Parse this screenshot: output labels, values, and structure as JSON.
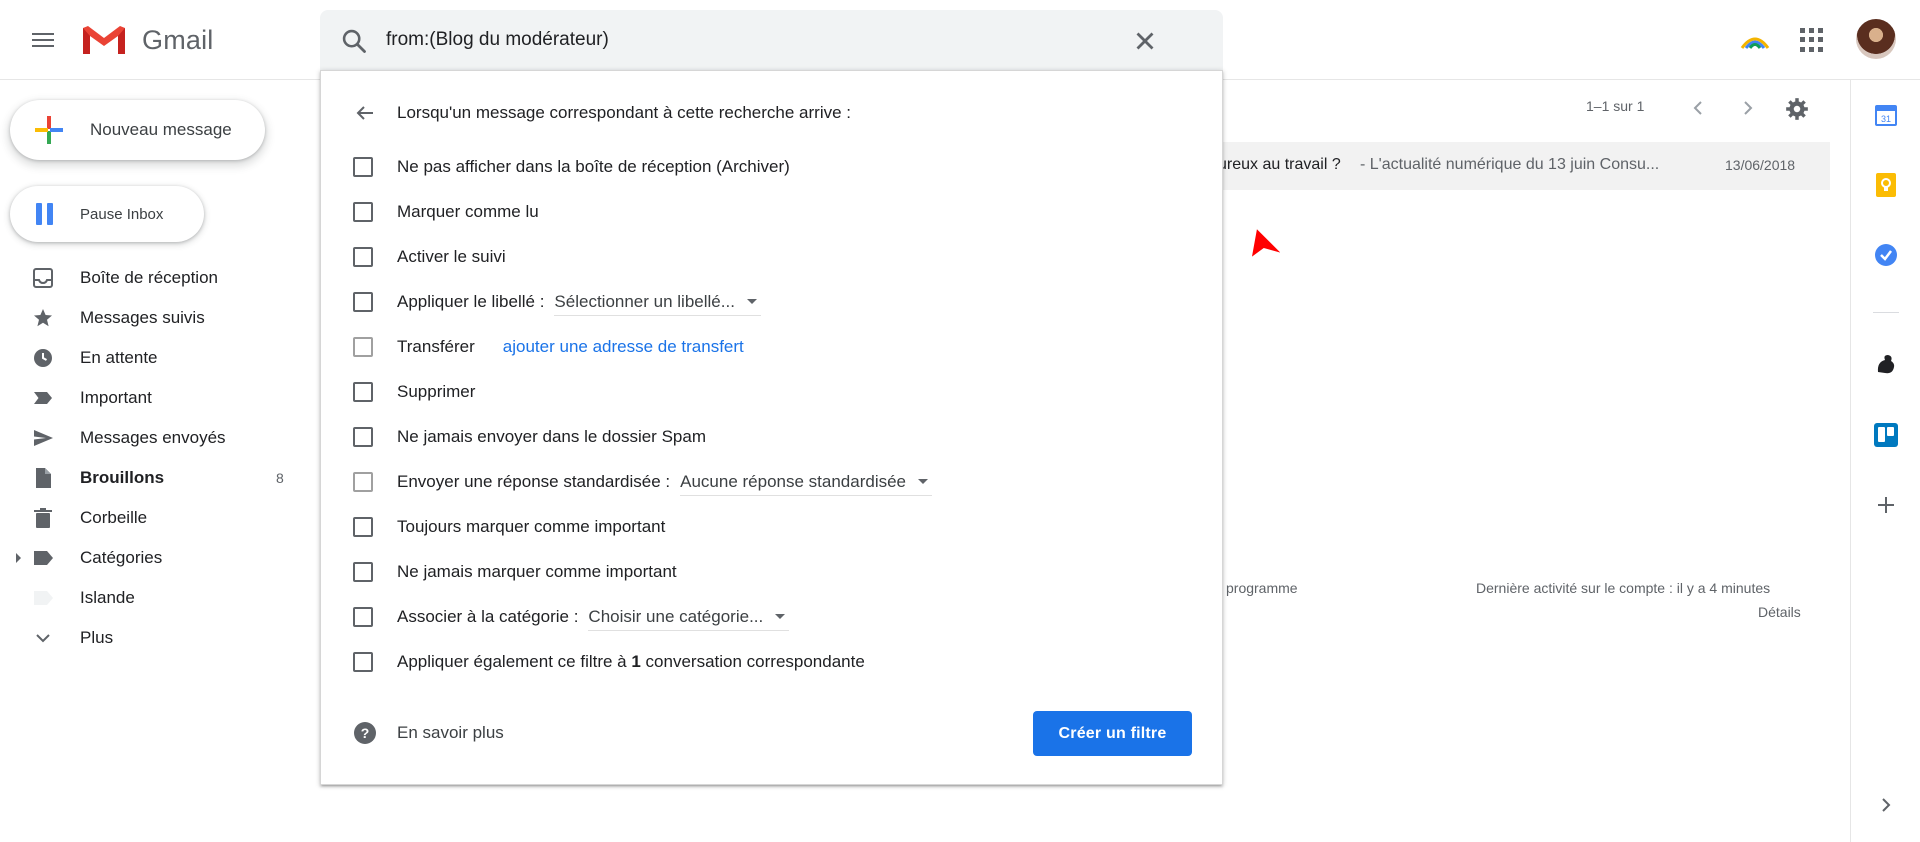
{
  "app": {
    "name": "Gmail"
  },
  "search": {
    "value": "from:(Blog du modérateur)"
  },
  "sidebar": {
    "compose_label": "Nouveau message",
    "pause_label": "Pause Inbox",
    "items": [
      {
        "label": "Boîte de réception",
        "icon": "inbox-icon"
      },
      {
        "label": "Messages suivis",
        "icon": "star-icon"
      },
      {
        "label": "En attente",
        "icon": "clock-icon"
      },
      {
        "label": "Important",
        "icon": "important-icon"
      },
      {
        "label": "Messages envoyés",
        "icon": "send-icon"
      },
      {
        "label": "Brouillons",
        "icon": "draft-icon",
        "count": "8",
        "bold": true
      },
      {
        "label": "Corbeille",
        "icon": "trash-icon"
      },
      {
        "label": "Catégories",
        "icon": "label-icon"
      },
      {
        "label": "Islande",
        "icon": "label-light-icon"
      },
      {
        "label": "Plus",
        "icon": "chevron-down-icon"
      }
    ]
  },
  "toolbar": {
    "pager_text": "1–1 sur 1"
  },
  "mail": {
    "subject": "ureux au travail ?",
    "snippet": "- L'actualité numérique du 13 juin Consu...",
    "date": "13/06/2018"
  },
  "footer": {
    "program_text": "programme",
    "activity_text": "Dernière activité sur le compte : il y a 4 minutes",
    "details_link": "Détails"
  },
  "filter": {
    "title": "Lorsqu'un message correspondant à cette recherche arrive :",
    "options": {
      "archive": "Ne pas afficher dans la boîte de réception (Archiver)",
      "mark_read": "Marquer comme lu",
      "star": "Activer le suivi",
      "apply_label": "Appliquer le libellé :",
      "apply_label_select": "Sélectionner un libellé...",
      "forward": "Transférer",
      "forward_link": "ajouter une adresse de transfert",
      "delete": "Supprimer",
      "never_spam": "Ne jamais envoyer dans le dossier Spam",
      "canned": "Envoyer une réponse standardisée :",
      "canned_select": "Aucune réponse standardisée",
      "always_important": "Toujours marquer comme important",
      "never_important": "Ne jamais marquer comme important",
      "category": "Associer à la catégorie :",
      "category_select": "Choisir une catégorie...",
      "also_apply_prefix": "Appliquer également ce filtre à ",
      "also_apply_count": "1",
      "also_apply_suffix": " conversation correspondante"
    },
    "learn_more": "En savoir plus",
    "create_button": "Créer un filtre"
  },
  "colors": {
    "primary_blue": "#1a73e8",
    "gmail_red": "#ea4335",
    "cursor_red": "#ff0000"
  }
}
